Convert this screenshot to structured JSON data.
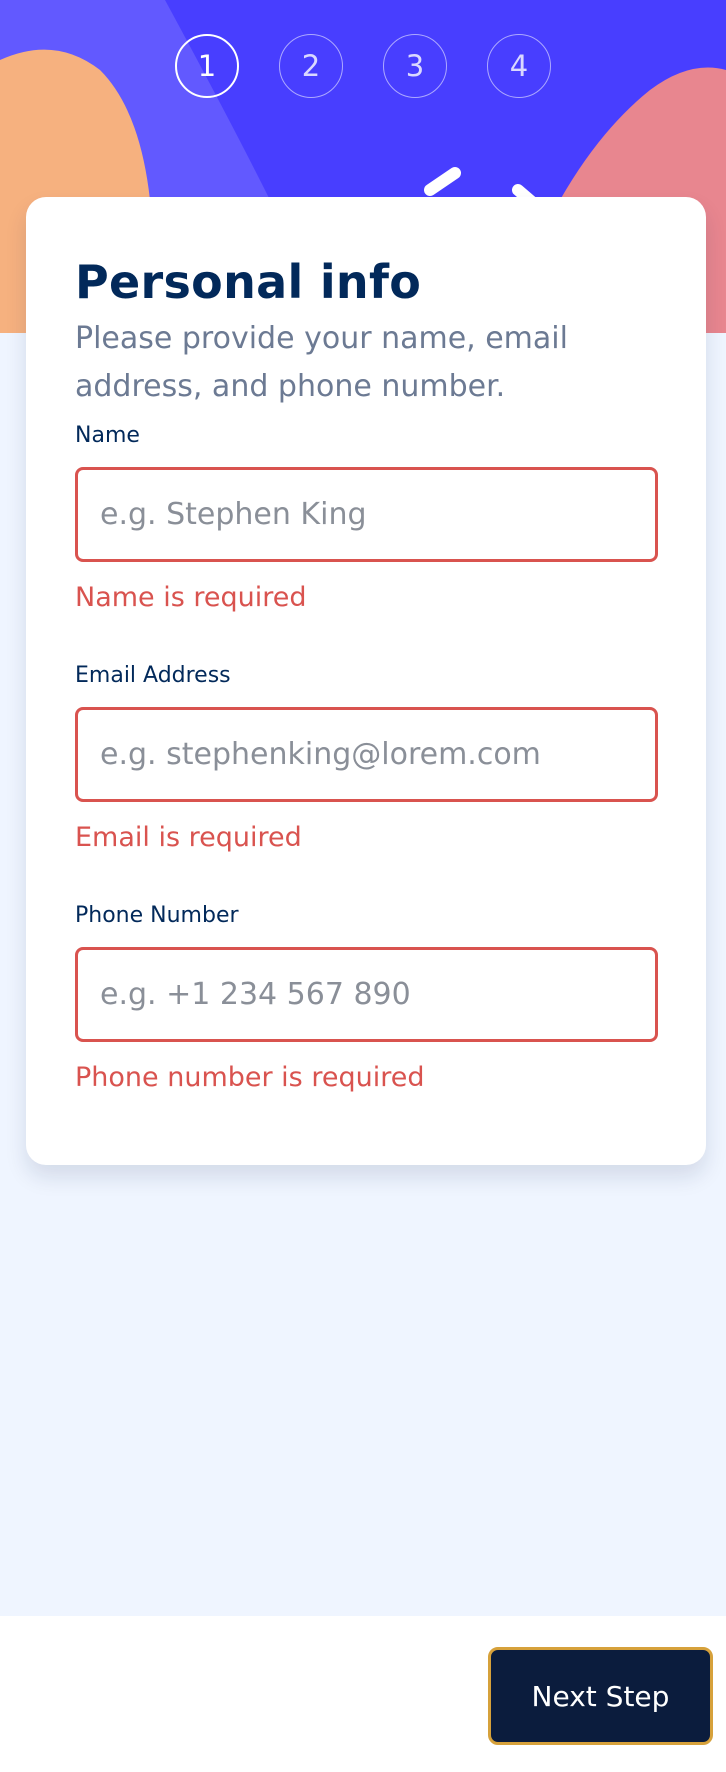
{
  "steps": [
    "1",
    "2",
    "3",
    "4"
  ],
  "active_step": 1,
  "form": {
    "title": "Personal info",
    "subtitle": "Please provide your name, email address, and phone number.",
    "name": {
      "label": "Name",
      "placeholder": "e.g. Stephen King",
      "value": "",
      "error": "Name is required"
    },
    "email": {
      "label": "Email Address",
      "placeholder": "e.g. stephenking@lorem.com",
      "value": "",
      "error": "Email is required"
    },
    "phone": {
      "label": "Phone Number",
      "placeholder": "e.g. +1 234 567 890",
      "value": "",
      "error": "Phone number is required"
    }
  },
  "footer": {
    "next_label": "Next Step"
  },
  "colors": {
    "hero_blue": "#483eff",
    "hero_light_blue": "#6259ff",
    "orange_blob": "#f6b17f",
    "pink_blob": "#e8868f",
    "error": "#d9534f",
    "title": "#02295a",
    "button_bg": "#0b1c3d",
    "button_border": "#d6a13b",
    "page_bg": "#eff5ff"
  }
}
